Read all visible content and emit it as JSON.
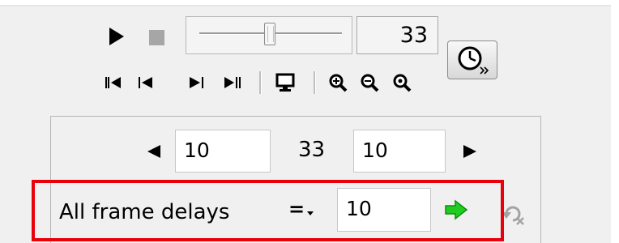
{
  "playback": {
    "play_icon": "play-icon",
    "stop_icon": "stop-icon",
    "slider_value": 33,
    "frame_number": "33"
  },
  "toolbar": {
    "icons": [
      "first-frame-icon",
      "prev-frame-icon",
      "next-frame-icon",
      "last-frame-icon",
      "monitor-icon",
      "zoom-in-icon",
      "zoom-out-icon",
      "zoom-reset-icon"
    ],
    "clock_icon": "clock-icon"
  },
  "frame_delay": {
    "prev_value": "10",
    "current_frame": "33",
    "next_value": "10",
    "all_label": "All frame delays",
    "all_value": "10",
    "operator": "="
  },
  "colors": {
    "highlight": "#e8000b",
    "apply_arrow": "#1fcc1f",
    "panel_bg": "#f0f0f0"
  }
}
